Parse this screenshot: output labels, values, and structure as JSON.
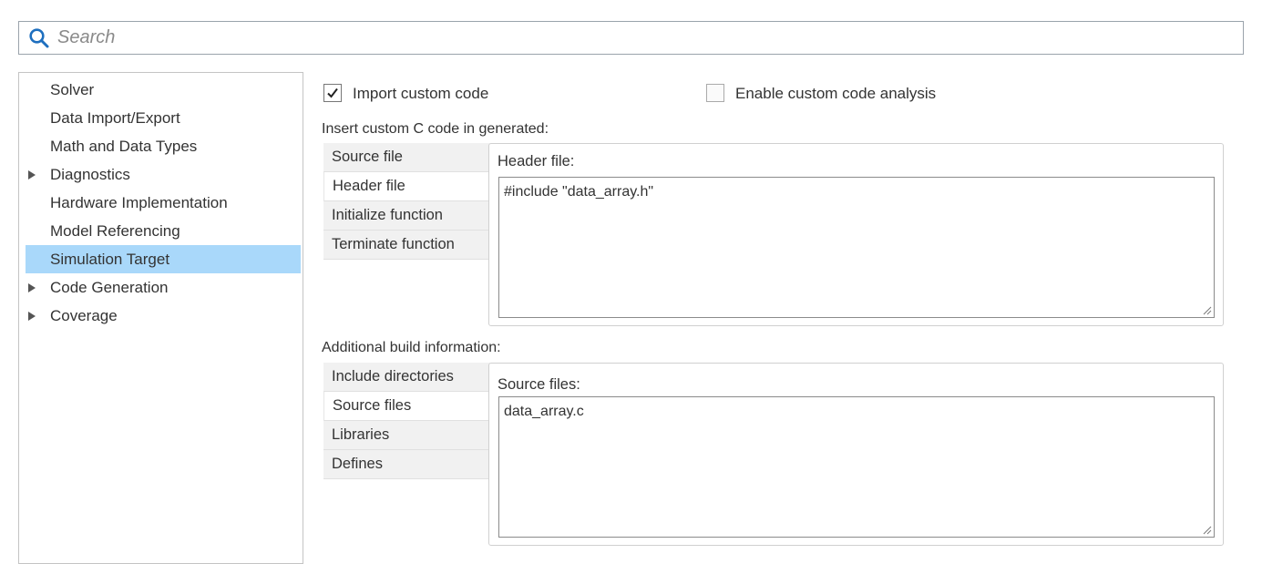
{
  "search": {
    "placeholder": "Search",
    "value": ""
  },
  "nav": {
    "items": [
      {
        "label": "Solver",
        "expandable": false,
        "selected": false
      },
      {
        "label": "Data Import/Export",
        "expandable": false,
        "selected": false
      },
      {
        "label": "Math and Data Types",
        "expandable": false,
        "selected": false
      },
      {
        "label": "Diagnostics",
        "expandable": true,
        "selected": false
      },
      {
        "label": "Hardware Implementation",
        "expandable": false,
        "selected": false
      },
      {
        "label": "Model Referencing",
        "expandable": false,
        "selected": false
      },
      {
        "label": "Simulation Target",
        "expandable": false,
        "selected": true
      },
      {
        "label": "Code Generation",
        "expandable": true,
        "selected": false
      },
      {
        "label": "Coverage",
        "expandable": true,
        "selected": false
      }
    ]
  },
  "options": {
    "import_custom_code": {
      "label": "Import custom code",
      "checked": true
    },
    "enable_analysis": {
      "label": "Enable custom code analysis",
      "checked": false
    }
  },
  "custom_code": {
    "section_label": "Insert custom C code in generated:",
    "tabs": [
      "Source file",
      "Header file",
      "Initialize function",
      "Terminate function"
    ],
    "active_tab": "Header file",
    "panel_title": "Header file:",
    "editor_text": "#include \"data_array.h\""
  },
  "build_info": {
    "section_label": "Additional build information:",
    "tabs": [
      "Include directories",
      "Source files",
      "Libraries",
      "Defines"
    ],
    "active_tab": "Source files",
    "panel_title": "Source files:",
    "editor_text": "data_array.c"
  },
  "colors": {
    "selection": "#a9d8fa",
    "search_icon": "#1e6fbf"
  }
}
